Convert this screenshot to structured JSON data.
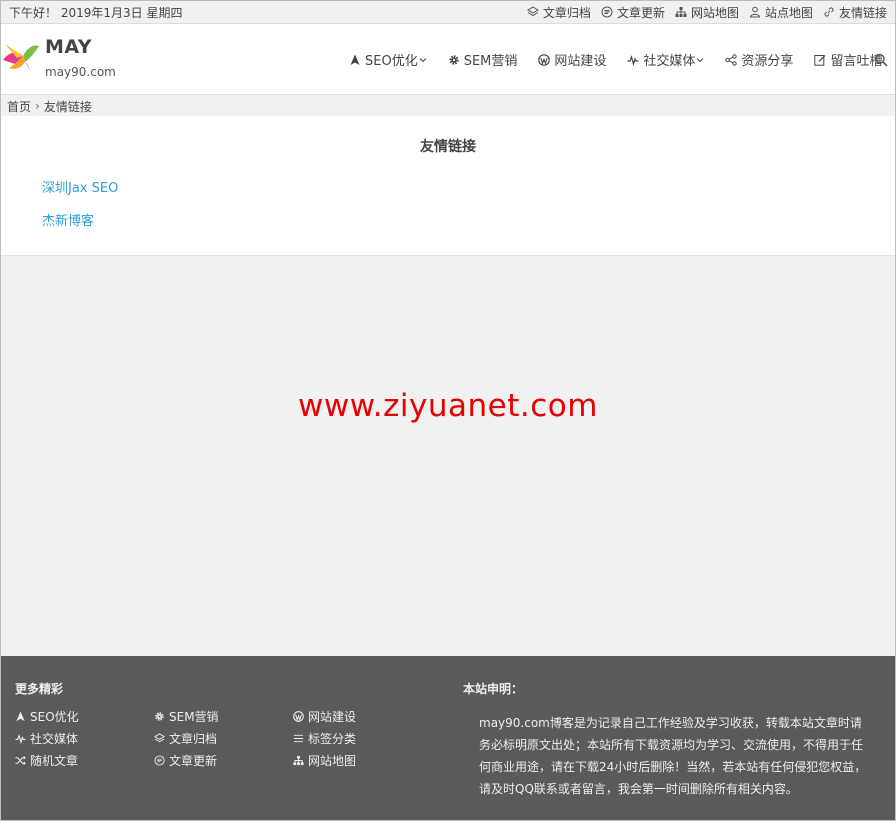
{
  "topbar": {
    "greeting": "下午好！ 2019年1月3日 星期四",
    "links": [
      {
        "label": "文章归档",
        "icon": "layers-icon"
      },
      {
        "label": "文章更新",
        "icon": "update-icon"
      },
      {
        "label": "网站地图",
        "icon": "sitemap-icon"
      },
      {
        "label": "站点地图",
        "icon": "user-map-icon"
      },
      {
        "label": "友情链接",
        "icon": "link-icon"
      }
    ]
  },
  "header": {
    "site_name": "MAY",
    "site_domain": "may90.com",
    "nav": [
      {
        "label": "SEO优化",
        "icon": "rocket-icon",
        "dropdown": true
      },
      {
        "label": "SEM营销",
        "icon": "gear-icon",
        "dropdown": false
      },
      {
        "label": "网站建设",
        "icon": "wordpress-icon",
        "dropdown": false
      },
      {
        "label": "社交媒体",
        "icon": "pulse-icon",
        "dropdown": true
      },
      {
        "label": "资源分享",
        "icon": "share-icon",
        "dropdown": false
      },
      {
        "label": "留言吐槽",
        "icon": "edit-icon",
        "dropdown": false
      }
    ],
    "search_icon": "search-icon"
  },
  "breadcrumb": {
    "home": "首页",
    "separator": "›",
    "current": "友情链接"
  },
  "content": {
    "title": "友情链接",
    "links": [
      "深圳Jax SEO",
      "杰新博客"
    ]
  },
  "watermark": "www.ziyuanet.com",
  "footer": {
    "more_title": "更多精彩",
    "links": [
      {
        "label": "SEO优化",
        "icon": "rocket-icon"
      },
      {
        "label": "SEM营销",
        "icon": "gear-icon"
      },
      {
        "label": "网站建设",
        "icon": "wordpress-icon"
      },
      {
        "label": "社交媒体",
        "icon": "pulse-icon"
      },
      {
        "label": "文章归档",
        "icon": "layers-icon"
      },
      {
        "label": "标签分类",
        "icon": "list-icon"
      },
      {
        "label": "随机文章",
        "icon": "shuffle-icon"
      },
      {
        "label": "文章更新",
        "icon": "update-icon"
      },
      {
        "label": "网站地图",
        "icon": "sitemap-icon"
      }
    ],
    "notice_title": "本站申明：",
    "notice_text": "may90.com博客是为记录自己工作经验及学习收获，转载本站文章时请务必标明原文出处；本站所有下载资源均为学习、交流使用，不得用于任何商业用途，请在下载24小时后删除！当然，若本站有任何侵犯您权益，请及时QQ联系或者留言，我会第一时间删除所有相关内容。"
  },
  "colors": {
    "link": "#2d9fd8",
    "watermark": "#e60000",
    "footer_bg": "#5a5a5a",
    "page_bg": "#f1f1f1"
  }
}
